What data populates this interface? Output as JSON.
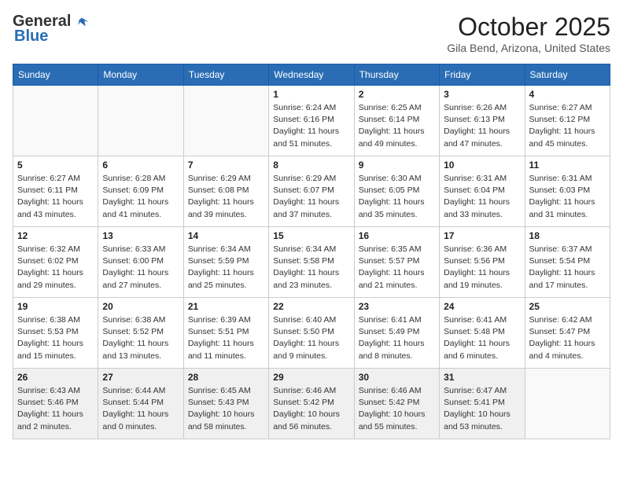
{
  "header": {
    "logo_general": "General",
    "logo_blue": "Blue",
    "month": "October 2025",
    "location": "Gila Bend, Arizona, United States"
  },
  "days_of_week": [
    "Sunday",
    "Monday",
    "Tuesday",
    "Wednesday",
    "Thursday",
    "Friday",
    "Saturday"
  ],
  "weeks": [
    [
      {
        "day": "",
        "info": ""
      },
      {
        "day": "",
        "info": ""
      },
      {
        "day": "",
        "info": ""
      },
      {
        "day": "1",
        "info": "Sunrise: 6:24 AM\nSunset: 6:16 PM\nDaylight: 11 hours\nand 51 minutes."
      },
      {
        "day": "2",
        "info": "Sunrise: 6:25 AM\nSunset: 6:14 PM\nDaylight: 11 hours\nand 49 minutes."
      },
      {
        "day": "3",
        "info": "Sunrise: 6:26 AM\nSunset: 6:13 PM\nDaylight: 11 hours\nand 47 minutes."
      },
      {
        "day": "4",
        "info": "Sunrise: 6:27 AM\nSunset: 6:12 PM\nDaylight: 11 hours\nand 45 minutes."
      }
    ],
    [
      {
        "day": "5",
        "info": "Sunrise: 6:27 AM\nSunset: 6:11 PM\nDaylight: 11 hours\nand 43 minutes."
      },
      {
        "day": "6",
        "info": "Sunrise: 6:28 AM\nSunset: 6:09 PM\nDaylight: 11 hours\nand 41 minutes."
      },
      {
        "day": "7",
        "info": "Sunrise: 6:29 AM\nSunset: 6:08 PM\nDaylight: 11 hours\nand 39 minutes."
      },
      {
        "day": "8",
        "info": "Sunrise: 6:29 AM\nSunset: 6:07 PM\nDaylight: 11 hours\nand 37 minutes."
      },
      {
        "day": "9",
        "info": "Sunrise: 6:30 AM\nSunset: 6:05 PM\nDaylight: 11 hours\nand 35 minutes."
      },
      {
        "day": "10",
        "info": "Sunrise: 6:31 AM\nSunset: 6:04 PM\nDaylight: 11 hours\nand 33 minutes."
      },
      {
        "day": "11",
        "info": "Sunrise: 6:31 AM\nSunset: 6:03 PM\nDaylight: 11 hours\nand 31 minutes."
      }
    ],
    [
      {
        "day": "12",
        "info": "Sunrise: 6:32 AM\nSunset: 6:02 PM\nDaylight: 11 hours\nand 29 minutes."
      },
      {
        "day": "13",
        "info": "Sunrise: 6:33 AM\nSunset: 6:00 PM\nDaylight: 11 hours\nand 27 minutes."
      },
      {
        "day": "14",
        "info": "Sunrise: 6:34 AM\nSunset: 5:59 PM\nDaylight: 11 hours\nand 25 minutes."
      },
      {
        "day": "15",
        "info": "Sunrise: 6:34 AM\nSunset: 5:58 PM\nDaylight: 11 hours\nand 23 minutes."
      },
      {
        "day": "16",
        "info": "Sunrise: 6:35 AM\nSunset: 5:57 PM\nDaylight: 11 hours\nand 21 minutes."
      },
      {
        "day": "17",
        "info": "Sunrise: 6:36 AM\nSunset: 5:56 PM\nDaylight: 11 hours\nand 19 minutes."
      },
      {
        "day": "18",
        "info": "Sunrise: 6:37 AM\nSunset: 5:54 PM\nDaylight: 11 hours\nand 17 minutes."
      }
    ],
    [
      {
        "day": "19",
        "info": "Sunrise: 6:38 AM\nSunset: 5:53 PM\nDaylight: 11 hours\nand 15 minutes."
      },
      {
        "day": "20",
        "info": "Sunrise: 6:38 AM\nSunset: 5:52 PM\nDaylight: 11 hours\nand 13 minutes."
      },
      {
        "day": "21",
        "info": "Sunrise: 6:39 AM\nSunset: 5:51 PM\nDaylight: 11 hours\nand 11 minutes."
      },
      {
        "day": "22",
        "info": "Sunrise: 6:40 AM\nSunset: 5:50 PM\nDaylight: 11 hours\nand 9 minutes."
      },
      {
        "day": "23",
        "info": "Sunrise: 6:41 AM\nSunset: 5:49 PM\nDaylight: 11 hours\nand 8 minutes."
      },
      {
        "day": "24",
        "info": "Sunrise: 6:41 AM\nSunset: 5:48 PM\nDaylight: 11 hours\nand 6 minutes."
      },
      {
        "day": "25",
        "info": "Sunrise: 6:42 AM\nSunset: 5:47 PM\nDaylight: 11 hours\nand 4 minutes."
      }
    ],
    [
      {
        "day": "26",
        "info": "Sunrise: 6:43 AM\nSunset: 5:46 PM\nDaylight: 11 hours\nand 2 minutes."
      },
      {
        "day": "27",
        "info": "Sunrise: 6:44 AM\nSunset: 5:44 PM\nDaylight: 11 hours\nand 0 minutes."
      },
      {
        "day": "28",
        "info": "Sunrise: 6:45 AM\nSunset: 5:43 PM\nDaylight: 10 hours\nand 58 minutes."
      },
      {
        "day": "29",
        "info": "Sunrise: 6:46 AM\nSunset: 5:42 PM\nDaylight: 10 hours\nand 56 minutes."
      },
      {
        "day": "30",
        "info": "Sunrise: 6:46 AM\nSunset: 5:42 PM\nDaylight: 10 hours\nand 55 minutes."
      },
      {
        "day": "31",
        "info": "Sunrise: 6:47 AM\nSunset: 5:41 PM\nDaylight: 10 hours\nand 53 minutes."
      },
      {
        "day": "",
        "info": ""
      }
    ]
  ]
}
